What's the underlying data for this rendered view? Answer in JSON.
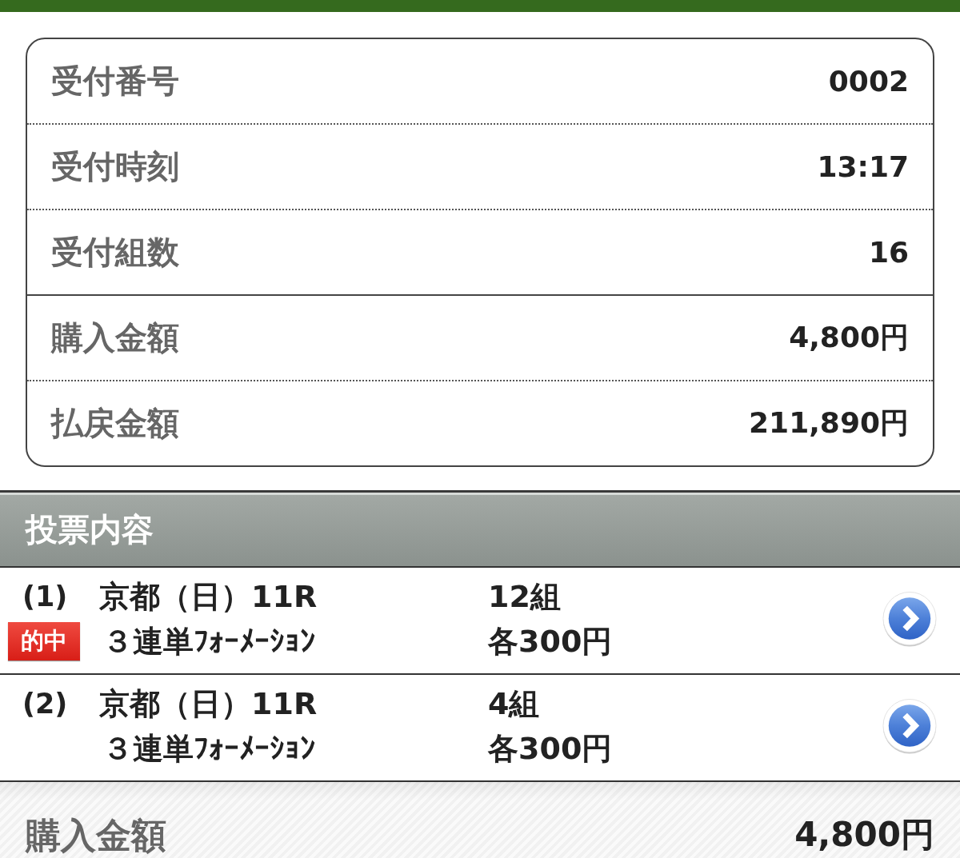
{
  "receipt": {
    "sections": [
      [
        {
          "label": "受付番号",
          "value": "0002"
        },
        {
          "label": "受付時刻",
          "value": "13:17"
        },
        {
          "label": "受付組数",
          "value": "16"
        }
      ],
      [
        {
          "label": "購入金額",
          "value": "4,800円"
        },
        {
          "label": "払戻金額",
          "value": "211,890円"
        }
      ]
    ]
  },
  "bets_section": {
    "title": "投票内容",
    "bets": [
      {
        "number": "(1)",
        "race": "京都（日）11R",
        "bet_type": "３連単ﾌｫｰﾒｰｼｮﾝ",
        "combinations": "12組",
        "unit_price": "各300円",
        "hit": true,
        "badge": "的中"
      },
      {
        "number": "(2)",
        "race": "京都（日）11R",
        "bet_type": "３連単ﾌｫｰﾒｰｼｮﾝ",
        "combinations": "4組",
        "unit_price": "各300円",
        "hit": false
      }
    ]
  },
  "total": {
    "label": "購入金額",
    "value": "4,800円"
  }
}
